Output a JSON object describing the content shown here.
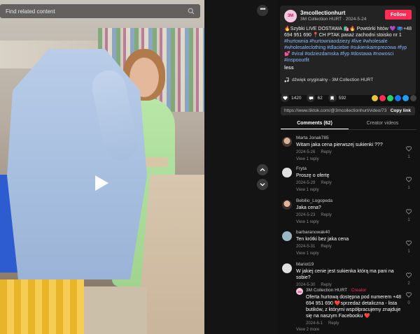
{
  "search": {
    "placeholder": "Find related content"
  },
  "author": {
    "name": "3mcollectionhurt",
    "avatar_text": "3M",
    "meta": "3M Collection HURT · 2024-5-24",
    "follow_label": "Follow"
  },
  "description": {
    "line1": "🔥Szybki LIVE DOSTAWA 🛍️🔥 Powtórki hitów 💜 📪+48 694 951 690 📍CH PTAK pasaż zachodni stoisko nr 1",
    "hashtags": "#hurtownia #hurtowniaodziezy #live #wholesale #wholesaleclothing #dlaciebie #sukienkaimprezowa #fyp💕 #viral #odziezdamska #fyp #dostawa #nowosci #inspooutfit",
    "less_label": "less",
    "music": "dźwięk oryginalny - 3M Collection HURT"
  },
  "stats": {
    "likes": "1420",
    "comments": "62",
    "saves": "592"
  },
  "link": {
    "url": "https://www.tiktok.com/@3mcollectionhurt/video/73...",
    "copy_label": "Copy link"
  },
  "tabs": {
    "comments": "Comments (62)",
    "creator_videos": "Creator videos"
  },
  "comments": [
    {
      "user": "Marta Jonak785",
      "text": "Witam jaka cena pierwszej sukienki ???",
      "date": "2024-5-26",
      "reply_label": "Reply",
      "replies": "View 1 reply",
      "likes": "1"
    },
    {
      "user": "Fryta",
      "text": "Proszę o ofertę",
      "date": "2024-5-29",
      "reply_label": "Reply",
      "replies": "View 1 reply",
      "likes": "1"
    },
    {
      "user": "Bebilio_Logopeda",
      "text": "Jaka cena?",
      "date": "2024-5-23",
      "reply_label": "Reply",
      "replies": "View 1 reply",
      "likes": "1"
    },
    {
      "user": "barbaranowak40",
      "text": "Ten krótki bez jaka cena",
      "date": "2024-5-31",
      "reply_label": "Reply",
      "replies": "View 1 reply",
      "likes": "1"
    },
    {
      "user": "Mariot19",
      "text": "W jakiej cenie jest sukienka którą ma pani na sobie?",
      "date": "2024-5-30",
      "reply_label": "Reply",
      "replies": "View 2 more",
      "likes": "2"
    }
  ],
  "creator_reply": {
    "user": "3M Collection HURT",
    "badge": "· Creator",
    "text": "Oferta hurtową dostępna pod numerem +48 694 951 690 ❤️sprzedaż detaliczna - lista butików, z którymi współpracujemy znajduje się na naszym Facebooku ❤️",
    "date": "2024-6-1",
    "reply_label": "Reply",
    "likes": "0"
  },
  "colors": {
    "accent": "#fe2c55",
    "hashtag": "#8cb8ff",
    "panel": "#121212"
  }
}
